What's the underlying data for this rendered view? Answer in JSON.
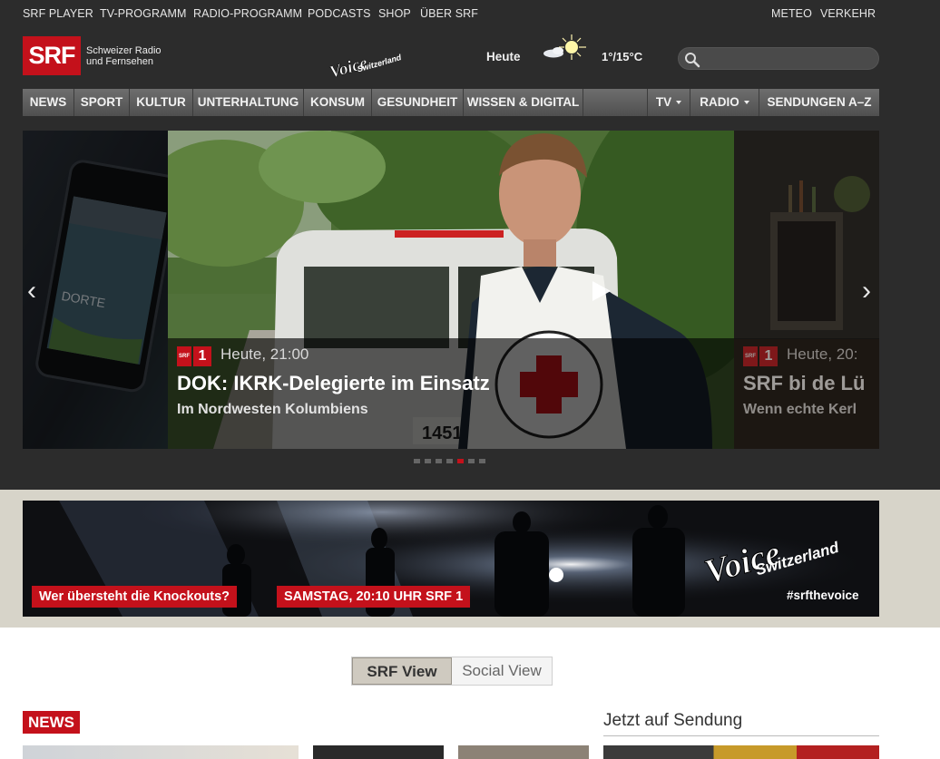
{
  "topbar": {
    "links": [
      "SRF PLAYER",
      "TV-PROGRAMM",
      "RADIO-PROGRAMM",
      "PODCASTS",
      "SHOP",
      "ÜBER SRF"
    ],
    "right_links": [
      "METEO",
      "VERKEHR"
    ]
  },
  "header": {
    "logo_text": "SRF",
    "logo_subtitle_line1": "Schweizer Radio",
    "logo_subtitle_line2": "und Fernsehen",
    "weather_day": "Heute",
    "weather_icon": "sun-cloud-icon",
    "temperature": "1°/15°C",
    "search_placeholder": ""
  },
  "nav": {
    "items": [
      "NEWS",
      "SPORT",
      "KULTUR",
      "UNTERHALTUNG",
      "KONSUM",
      "GESUNDHEIT",
      "WISSEN & DIGITAL"
    ],
    "right_items": [
      "TV",
      "RADIO",
      "SENDUNGEN A–Z"
    ]
  },
  "slider": {
    "current": {
      "channel_logo": "SRF 1",
      "time": "Heute, 21:00",
      "title": "DOK: IKRK-Delegierte im Einsatz",
      "subtitle": "Im Nordwesten Kolumbiens"
    },
    "next": {
      "time": "Heute, 20:",
      "title": "SRF bi de Lü",
      "subtitle": "Wenn echte Kerl"
    },
    "prev_arrow": "‹",
    "next_arrow": "›",
    "dot_count": 7,
    "active_dot": 4
  },
  "promo": {
    "tag_left": "Wer übersteht die Knockouts?",
    "tag_right": "SAMSTAG, 20:10 UHR SRF 1",
    "hashtag": "#srfthevoice",
    "brand_word1": "Voice",
    "brand_word2": "Switzerland"
  },
  "views": {
    "srf_view": "SRF View",
    "social_view": "Social View"
  },
  "sections": {
    "news_label": "NEWS",
    "now_on_air": "Jetzt auf Sendung"
  },
  "colors": {
    "brand_red": "#c4111b",
    "header_bg": "#2c2c2c",
    "promo_bg": "#d7d4c9"
  }
}
